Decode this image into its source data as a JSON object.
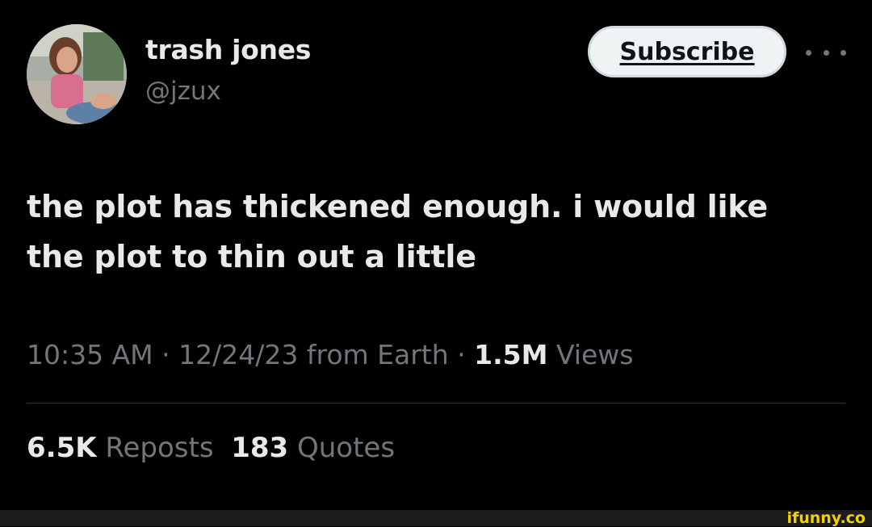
{
  "author": {
    "name": "trash jones",
    "handle": "@jzux"
  },
  "header": {
    "subscribe_label": "Subscribe",
    "more_icon": "more-horizontal-icon"
  },
  "tweet": {
    "text": "the plot has thickened enough. i would like the plot to thin out a little"
  },
  "meta": {
    "time": "10:35 AM",
    "separator": "·",
    "date": "12/24/23",
    "source": "from Earth",
    "views_count": "1.5M",
    "views_label": "Views"
  },
  "stats": {
    "reposts_count": "6.5K",
    "reposts_label": "Reposts",
    "quotes_count": "183",
    "quotes_label": "Quotes"
  },
  "footer": {
    "watermark": "ifunny.co"
  },
  "colors": {
    "background": "#000000",
    "primary_text": "#e7e9ea",
    "secondary_text": "#71767b",
    "watermark": "#f5d000"
  }
}
